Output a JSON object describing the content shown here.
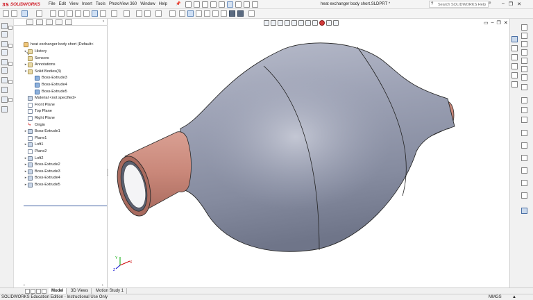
{
  "app": {
    "logo_ds": "3S",
    "logo_text": "SOLIDWORKS",
    "document_title": "heat exchanger body short.SLDPRT *"
  },
  "menu": [
    "File",
    "Edit",
    "View",
    "Insert",
    "Tools",
    "PhotoView 360",
    "Window",
    "Help"
  ],
  "search": {
    "placeholder": "Search SOLIDWORKS Help"
  },
  "window_buttons": {
    "minimize": "–",
    "restore": "❐",
    "close": "✕"
  },
  "tree": {
    "root": "heat exchanger body short  (Default<",
    "items": [
      {
        "label": "History",
        "expand": "▸",
        "icon": "folder"
      },
      {
        "label": "Sensors",
        "expand": "",
        "icon": "folder"
      },
      {
        "label": "Annotations",
        "expand": "▸",
        "icon": "folder"
      },
      {
        "label": "Solid Bodies(3)",
        "expand": "▾",
        "icon": "folder"
      },
      {
        "label": "Boss-Extrude3",
        "expand": "",
        "icon": "body",
        "indent": 1
      },
      {
        "label": "Boss-Extrude4",
        "expand": "",
        "icon": "body",
        "indent": 1
      },
      {
        "label": "Boss-Extrude5",
        "expand": "",
        "icon": "body",
        "indent": 1
      },
      {
        "label": "Material <not specified>",
        "expand": "",
        "icon": "feature"
      },
      {
        "label": "Front Plane",
        "expand": "",
        "icon": "plane"
      },
      {
        "label": "Top Plane",
        "expand": "",
        "icon": "plane"
      },
      {
        "label": "Right Plane",
        "expand": "",
        "icon": "plane"
      },
      {
        "label": "Origin",
        "expand": "",
        "icon": "origin"
      },
      {
        "label": "Boss-Extrude1",
        "expand": "▸",
        "icon": "feature"
      },
      {
        "label": "Plane1",
        "expand": "",
        "icon": "plane"
      },
      {
        "label": "Loft1",
        "expand": "▸",
        "icon": "feature"
      },
      {
        "label": "Plane2",
        "expand": "",
        "icon": "plane"
      },
      {
        "label": "Loft2",
        "expand": "▸",
        "icon": "feature"
      },
      {
        "label": "Boss-Extrude2",
        "expand": "▸",
        "icon": "feature"
      },
      {
        "label": "Boss-Extrude3",
        "expand": "▸",
        "icon": "feature"
      },
      {
        "label": "Boss-Extrude4",
        "expand": "▸",
        "icon": "feature"
      },
      {
        "label": "Boss-Extrude5",
        "expand": "▸",
        "icon": "feature"
      }
    ]
  },
  "tabs": [
    {
      "label": "Model",
      "active": true
    },
    {
      "label": "3D Views",
      "active": false
    },
    {
      "label": "Motion Study 1",
      "active": false
    }
  ],
  "status": {
    "text": "SOLIDWORKS Education Edition - Instructional Use Only",
    "units": "MMGS",
    "arrow": "▲"
  },
  "triad": {
    "x": "X",
    "y": "Y",
    "z": "Z"
  },
  "colors": {
    "body_gray": "#8f95a8",
    "pipe_copper": "#c98779",
    "accent_red": "#d0202b"
  }
}
